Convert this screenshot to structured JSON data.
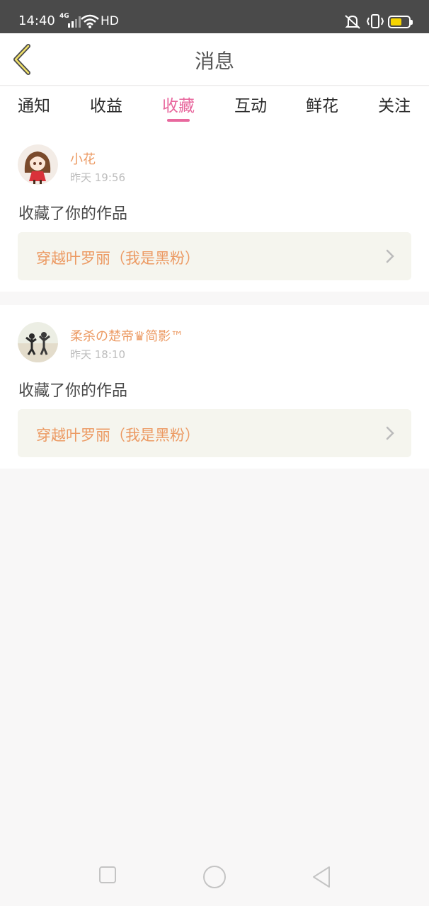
{
  "status_bar": {
    "time": "14:40",
    "network": "4G",
    "hd": "HD",
    "battery_level": 0.45,
    "icons": [
      "signal-icon",
      "wifi-icon",
      "mute-icon",
      "vibrate-icon",
      "battery-icon"
    ]
  },
  "header": {
    "title": "消息",
    "back_icon": "chevron-left-icon"
  },
  "tabs": [
    {
      "label": "通知",
      "active": false
    },
    {
      "label": "收益",
      "active": false
    },
    {
      "label": "收藏",
      "active": true
    },
    {
      "label": "互动",
      "active": false
    },
    {
      "label": "鲜花",
      "active": false
    },
    {
      "label": "关注",
      "active": false
    }
  ],
  "messages": [
    {
      "user": "小花",
      "time": "昨天 19:56",
      "action": "收藏了你的作品",
      "work_title": "穿越叶罗丽（我是黑粉）"
    },
    {
      "user": "柔杀の楚帝♛简影™",
      "time": "昨天 18:10",
      "action": "收藏了你的作品",
      "work_title": "穿越叶罗丽（我是黑粉）"
    }
  ],
  "colors": {
    "accent": "#e8689e",
    "username": "#ec9a63",
    "work_bg": "#f5f5ee",
    "page_bg": "#f8f7f7",
    "status_bar_bg": "#4a4a4a"
  },
  "nav_bar": [
    "recents-square-icon",
    "home-circle-icon",
    "back-triangle-icon"
  ]
}
